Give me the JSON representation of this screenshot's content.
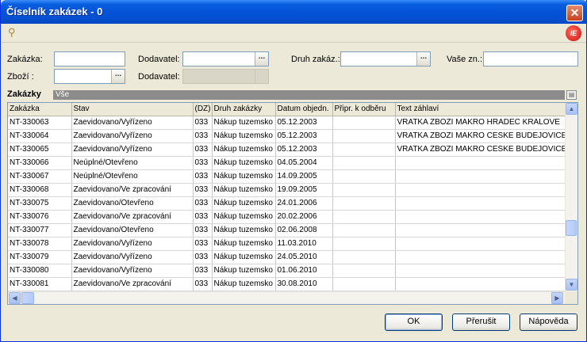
{
  "window": {
    "title": "Číselník zakázek - 0",
    "close_icon": "close-icon"
  },
  "toolbar": {
    "search_icon": "search-icon",
    "logo_text": "iE"
  },
  "filters": {
    "zakazka_label": "Zakázka:",
    "zakazka_value": "",
    "dodavatel_label": "Dodavatel:",
    "dodavatel_value": "",
    "druh_label": "Druh zakáz.:",
    "druh_value": "",
    "vase_label": "Vaše zn.:",
    "vase_value": "",
    "zbozi_label": "Zboží  :",
    "zbozi_value": "",
    "dodavatel2_label": "Dodavatel:",
    "dodavatel2_value": "",
    "browse": "..."
  },
  "grid": {
    "title": "Zakázky",
    "filter": "Vše",
    "columns": [
      "Zakázka",
      "Stav",
      "(DZ)",
      "Druh zakázky",
      "Datum objedn.",
      "Připr. k odběru",
      "Text záhlaví"
    ],
    "rows": [
      [
        "NT-330063",
        "Zaevidovano/Vyřízeno",
        "033",
        "Nákup tuzemsko",
        "05.12.2003",
        "",
        "VRATKA ZBOZI MAKRO HRADEC KRALOVE"
      ],
      [
        "NT-330064",
        "Zaevidovano/Vyřízeno",
        "033",
        "Nákup tuzemsko",
        "05.12.2003",
        "",
        "VRATKA ZBOZI MAKRO CESKE BUDEJOVICE"
      ],
      [
        "NT-330065",
        "Zaevidovano/Vyřízeno",
        "033",
        "Nákup tuzemsko",
        "05.12.2003",
        "",
        "VRATKA ZBOZI  MAKRO CESKE BUDEJOVICE"
      ],
      [
        "NT-330066",
        "Neúplné/Otevřeno",
        "033",
        "Nákup tuzemsko",
        "04.05.2004",
        "",
        ""
      ],
      [
        "NT-330067",
        "Neúplné/Otevřeno",
        "033",
        "Nákup tuzemsko",
        "14.09.2005",
        "",
        ""
      ],
      [
        "NT-330068",
        "Zaevidovano/Ve zpracování",
        "033",
        "Nákup tuzemsko",
        "19.09.2005",
        "",
        ""
      ],
      [
        "NT-330075",
        "Zaevidovano/Otevřeno",
        "033",
        "Nákup tuzemsko",
        "24.01.2006",
        "",
        ""
      ],
      [
        "NT-330076",
        "Zaevidovano/Ve zpracování",
        "033",
        "Nákup tuzemsko",
        "20.02.2006",
        "",
        ""
      ],
      [
        "NT-330077",
        "Zaevidovano/Otevřeno",
        "033",
        "Nákup tuzemsko",
        "02.06.2008",
        "",
        ""
      ],
      [
        "NT-330078",
        "Zaevidovano/Vyřízeno",
        "033",
        "Nákup tuzemsko",
        "11.03.2010",
        "",
        ""
      ],
      [
        "NT-330079",
        "Zaevidovano/Vyřízeno",
        "033",
        "Nákup tuzemsko",
        "24.05.2010",
        "",
        ""
      ],
      [
        "NT-330080",
        "Zaevidovano/Vyřízeno",
        "033",
        "Nákup tuzemsko",
        "01.06.2010",
        "",
        ""
      ],
      [
        "NT-330081",
        "Zaevidovano/Ve zpracování",
        "033",
        "Nákup tuzemsko",
        "30.08.2010",
        "",
        ""
      ]
    ]
  },
  "buttons": {
    "ok": "OK",
    "cancel": "Přerušit",
    "help": "Nápověda"
  },
  "colors": {
    "titlebar": "#0553d8",
    "face": "#ece9d8",
    "field_border": "#7f9db9"
  }
}
